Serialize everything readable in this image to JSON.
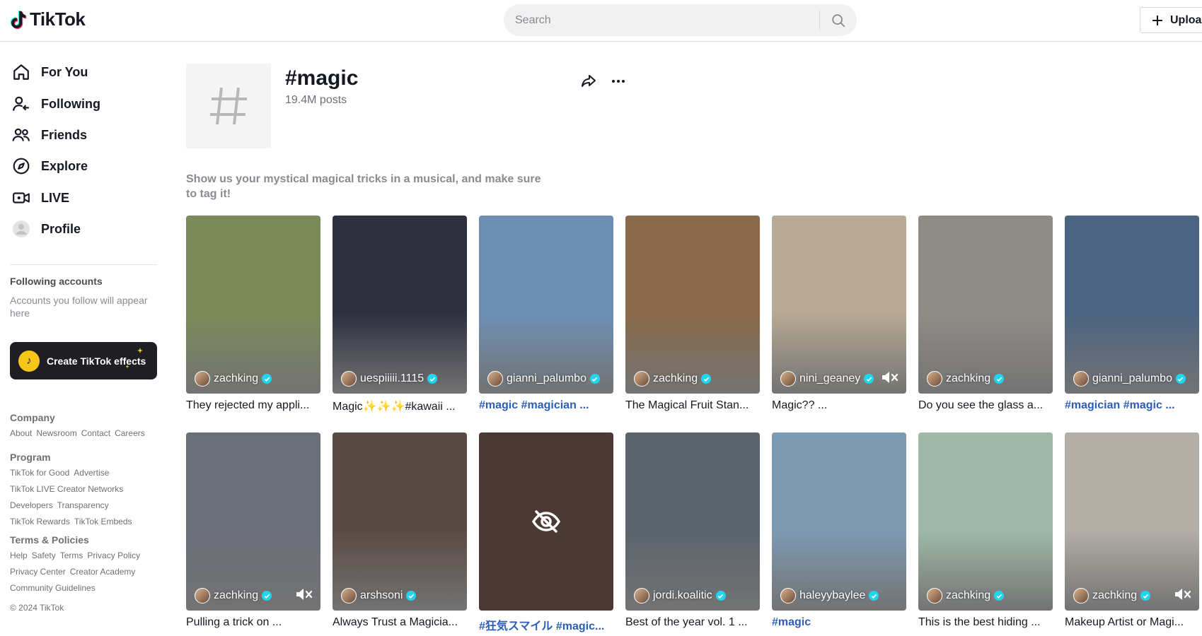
{
  "header": {
    "logo_text": "TikTok",
    "search_placeholder": "Search",
    "upload_label": "Uploa"
  },
  "sidebar": {
    "nav": [
      {
        "label": "For You",
        "icon": "home-icon"
      },
      {
        "label": "Following",
        "icon": "following-icon"
      },
      {
        "label": "Friends",
        "icon": "friends-icon"
      },
      {
        "label": "Explore",
        "icon": "compass-icon"
      },
      {
        "label": "LIVE",
        "icon": "live-icon"
      },
      {
        "label": "Profile",
        "icon": "profile-avatar-icon"
      }
    ],
    "following_title": "Following accounts",
    "following_desc": "Accounts you follow will appear here",
    "effects_label": "Create TikTok effects",
    "footer": {
      "company_title": "Company",
      "company_links": [
        "About",
        "Newsroom",
        "Contact",
        "Careers"
      ],
      "program_title": "Program",
      "program_links": [
        "TikTok for Good",
        "Advertise",
        "TikTok LIVE Creator Networks",
        "Developers",
        "Transparency",
        "TikTok Rewards",
        "TikTok Embeds"
      ],
      "terms_title": "Terms & Policies",
      "terms_links": [
        "Help",
        "Safety",
        "Terms",
        "Privacy Policy",
        "Privacy Center",
        "Creator Academy",
        "Community Guidelines"
      ],
      "copyright": "© 2024 TikTok"
    }
  },
  "tag": {
    "title": "#magic",
    "posts": "19.4M posts",
    "description": "Show us your mystical magical tricks in a musical, and make sure to tag it!"
  },
  "videos": [
    {
      "author": "zachking",
      "caption": "They rejected my appli...",
      "caption_is_tag": false,
      "muted": false,
      "hidden": false,
      "bg": "#7c8a5a"
    },
    {
      "author": "uespiiiii.1115",
      "caption": "Magic✨✨✨#kawaii ...",
      "caption_is_tag": false,
      "muted": false,
      "hidden": false,
      "bg": "#2e3040"
    },
    {
      "author": "gianni_palumbo",
      "caption": "#magic #magician ...",
      "caption_is_tag": true,
      "muted": false,
      "hidden": false,
      "bg": "#6d8fb5"
    },
    {
      "author": "zachking",
      "caption": "The Magical Fruit Stan...",
      "caption_is_tag": false,
      "muted": false,
      "hidden": false,
      "bg": "#8a6a4a"
    },
    {
      "author": "nini_geaney",
      "caption": "Magic?? ...",
      "caption_is_tag": false,
      "muted": true,
      "hidden": false,
      "bg": "#b7a994"
    },
    {
      "author": "zachking",
      "caption": "Do you see the glass a...",
      "caption_is_tag": false,
      "muted": false,
      "hidden": false,
      "bg": "#8f8c86"
    },
    {
      "author": "gianni_palumbo",
      "caption": "#magician #magic ...",
      "caption_is_tag": true,
      "muted": false,
      "hidden": false,
      "bg": "#4b6482"
    },
    {
      "author": "zachking",
      "caption": "Pulling a trick on ...",
      "caption_is_tag": false,
      "muted": true,
      "hidden": false,
      "bg": "#6a6e78"
    },
    {
      "author": "arshsoni",
      "caption": "Always Trust a Magicia...",
      "caption_is_tag": false,
      "muted": false,
      "hidden": false,
      "bg": "#5a4a44"
    },
    {
      "author": "",
      "caption": "#狂気スマイル #magic...",
      "caption_is_tag": true,
      "muted": false,
      "hidden": true,
      "bg": "#4a3a33"
    },
    {
      "author": "jordi.koalitic",
      "caption": "Best of the year vol. 1 ...",
      "caption_is_tag": false,
      "muted": false,
      "hidden": false,
      "bg": "#5b646c"
    },
    {
      "author": "haleyybaylee",
      "caption": "#magic",
      "caption_is_tag": true,
      "muted": false,
      "hidden": false,
      "bg": "#7d9ab3"
    },
    {
      "author": "zachking",
      "caption": "This is the best hiding ...",
      "caption_is_tag": false,
      "muted": false,
      "hidden": false,
      "bg": "#9fb9a8"
    },
    {
      "author": "zachking",
      "caption": "Makeup Artist or Magi...",
      "caption_is_tag": false,
      "muted": true,
      "hidden": false,
      "bg": "#b3aea6"
    }
  ]
}
